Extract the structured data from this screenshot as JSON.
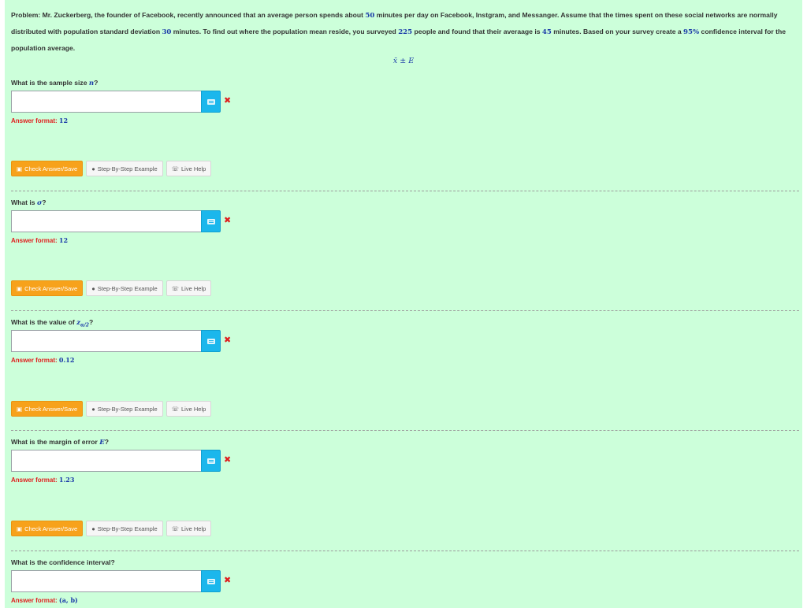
{
  "problem": {
    "prefix": "Problem: Mr. Zuckerberg, the founder of Facebook, recently announced that an average person spends about ",
    "n1": "50",
    "p2": " minutes per day on Facebook, Instgram, and Messanger. Assume that the times spent on these social networks are normally distributed with population standard deviation ",
    "n2": "30",
    "p3": " minutes. To find out where the population mean reside, you surveyed ",
    "n3": "225",
    "p4": " people and found that their averaage is ",
    "n4": "45",
    "p5": " minutes. Based on your survey create a ",
    "n5": "95%",
    "p6": " confidence interval for the population average."
  },
  "formula": "x̄ ± E",
  "questions": [
    {
      "pre": "What is the sample size ",
      "math": "n",
      "post": "?",
      "format_label": "Answer format: ",
      "format_value": "12",
      "value": ""
    },
    {
      "pre": "What is ",
      "math": "σ",
      "post": "?",
      "format_label": "Answer format: ",
      "format_value": "12",
      "value": ""
    },
    {
      "pre": "What is the value of ",
      "math": "z",
      "sub": "α/2",
      "post": "?",
      "format_label": "Answer format: ",
      "format_value": "0.12",
      "value": ""
    },
    {
      "pre": "What is the margin of error ",
      "math": "E",
      "post": "?",
      "format_label": "Answer format: ",
      "format_value": "1.23",
      "value": ""
    },
    {
      "pre": "What is the confidence interval?",
      "math": "",
      "post": "",
      "format_label": "Answer format: ",
      "format_value": "(a, b)",
      "value": ""
    }
  ],
  "buttons": {
    "check": "Check Answer/Save",
    "example": "Step-By-Step Example",
    "help": "Live Help"
  },
  "icons": {
    "check": "save-icon",
    "example": "info-circle-icon",
    "help": "phone-icon",
    "keyboard": "keyboard-icon",
    "incorrect": "x-mark-icon"
  },
  "colors": {
    "panel_bg": "#ccffda",
    "accent_math": "#1a3aa8",
    "check_button": "#f7a21b",
    "keyboard_button": "#1bb7ec",
    "error": "#e01e1e"
  }
}
